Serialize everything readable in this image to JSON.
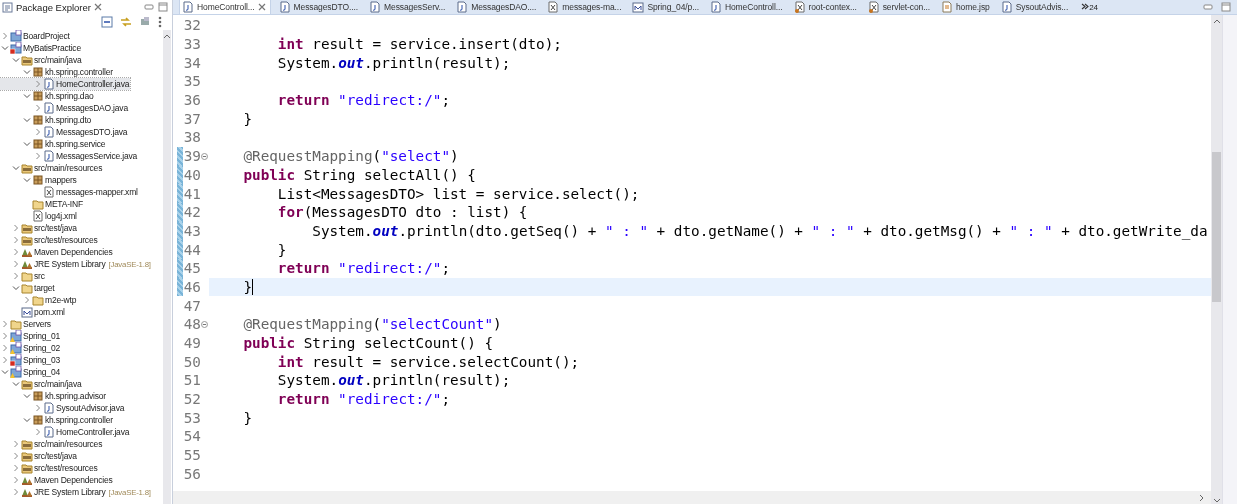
{
  "explorer": {
    "title": "Package Explorer",
    "tree": [
      {
        "label": "BoardProject",
        "kind": "project",
        "error": false,
        "warning": false,
        "expanded": false
      },
      {
        "label": "MyBatisPractice",
        "kind": "project",
        "error": true,
        "warning": false,
        "expanded": true,
        "children": [
          {
            "label": "src/main/java",
            "kind": "srcfolder",
            "expanded": true,
            "children": [
              {
                "label": "kh.spring.controller",
                "kind": "package",
                "expanded": true,
                "children": [
                  {
                    "label": "HomeController.java",
                    "kind": "java",
                    "expanded": false,
                    "selected": true
                  }
                ]
              },
              {
                "label": "kh.spring.dao",
                "kind": "package",
                "expanded": true,
                "children": [
                  {
                    "label": "MessagesDAO.java",
                    "kind": "java",
                    "expanded": false
                  }
                ]
              },
              {
                "label": "kh.spring.dto",
                "kind": "package",
                "expanded": true,
                "children": [
                  {
                    "label": "MessagesDTO.java",
                    "kind": "java",
                    "expanded": false
                  }
                ]
              },
              {
                "label": "kh.spring.service",
                "kind": "package",
                "expanded": true,
                "children": [
                  {
                    "label": "MessagesService.java",
                    "kind": "java",
                    "expanded": false
                  }
                ]
              }
            ]
          },
          {
            "label": "src/main/resources",
            "kind": "srcfolder",
            "expanded": true,
            "children": [
              {
                "label": "mappers",
                "kind": "package",
                "expanded": true,
                "children": [
                  {
                    "label": "messages-mapper.xml",
                    "kind": "xml"
                  }
                ]
              },
              {
                "label": "META-INF",
                "kind": "folder"
              },
              {
                "label": "log4j.xml",
                "kind": "xml"
              }
            ]
          },
          {
            "label": "src/test/java",
            "kind": "srcfolder",
            "expanded": false
          },
          {
            "label": "src/test/resources",
            "kind": "srcfolder",
            "expanded": false
          },
          {
            "label": "Maven Dependencies",
            "kind": "library",
            "expanded": false
          },
          {
            "label": "JRE System Library",
            "decoration": "[JavaSE-1.8]",
            "kind": "library",
            "expanded": false
          },
          {
            "label": "src",
            "kind": "folder",
            "expanded": false
          },
          {
            "label": "target",
            "kind": "folder",
            "expanded": true,
            "children": [
              {
                "label": "m2e-wtp",
                "kind": "folder",
                "expanded": false
              }
            ]
          },
          {
            "label": "pom.xml",
            "kind": "pom"
          }
        ]
      },
      {
        "label": "Servers",
        "kind": "folder",
        "expanded": false
      },
      {
        "label": "Spring_01",
        "kind": "project",
        "error": false,
        "warning": true,
        "expanded": false
      },
      {
        "label": "Spring_02",
        "kind": "project",
        "error": false,
        "warning": true,
        "expanded": false
      },
      {
        "label": "Spring_03",
        "kind": "project",
        "error": true,
        "warning": false,
        "expanded": false
      },
      {
        "label": "Spring_04",
        "kind": "project",
        "error": false,
        "warning": true,
        "expanded": true,
        "children": [
          {
            "label": "src/main/java",
            "kind": "srcfolder",
            "expanded": true,
            "children": [
              {
                "label": "kh.spring.advisor",
                "kind": "package",
                "expanded": true,
                "children": [
                  {
                    "label": "SysoutAdvisor.java",
                    "kind": "java",
                    "expanded": false
                  }
                ]
              },
              {
                "label": "kh.spring.controller",
                "kind": "package",
                "expanded": true,
                "children": [
                  {
                    "label": "HomeController.java",
                    "kind": "java",
                    "expanded": false
                  }
                ]
              }
            ]
          },
          {
            "label": "src/main/resources",
            "kind": "srcfolder",
            "expanded": false
          },
          {
            "label": "src/test/java",
            "kind": "srcfolder",
            "expanded": false
          },
          {
            "label": "src/test/resources",
            "kind": "srcfolder",
            "expanded": false
          },
          {
            "label": "Maven Dependencies",
            "kind": "library",
            "expanded": false
          },
          {
            "label": "JRE System Library",
            "decoration": "[JavaSE-1.8]",
            "kind": "library",
            "expanded": false
          }
        ]
      }
    ]
  },
  "editor": {
    "tabs": [
      {
        "label": "HomeControll...",
        "kind": "java",
        "selected": true
      },
      {
        "label": "MessagesDTO....",
        "kind": "java",
        "selected": false
      },
      {
        "label": "MessagesServ...",
        "kind": "java",
        "selected": false
      },
      {
        "label": "MessagesDAO....",
        "kind": "java",
        "selected": false
      },
      {
        "label": "messages-ma...",
        "kind": "xml",
        "selected": false
      },
      {
        "label": "Spring_04/p...",
        "kind": "pom",
        "selected": false
      },
      {
        "label": "HomeControll...",
        "kind": "java",
        "selected": false
      },
      {
        "label": "root-contex...",
        "kind": "springxml",
        "selected": false
      },
      {
        "label": "servlet-con...",
        "kind": "springxml",
        "selected": false
      },
      {
        "label": "home.jsp",
        "kind": "jsp",
        "selected": false
      },
      {
        "label": "SysoutAdvis...",
        "kind": "java",
        "selected": false
      }
    ],
    "overflow_count": "24",
    "lines": [
      {
        "number": "32"
      },
      {
        "number": "33",
        "tokens": [
          {
            "kind": "keyword",
            "text": "        int"
          },
          {
            "kind": "plain",
            "text": " result = service.insert(dto);"
          }
        ]
      },
      {
        "number": "34",
        "tokens": [
          {
            "kind": "plain",
            "text": "        System."
          },
          {
            "kind": "field",
            "text": "out"
          },
          {
            "kind": "plain",
            "text": ".println(result);"
          }
        ]
      },
      {
        "number": "35"
      },
      {
        "number": "36",
        "tokens": [
          {
            "kind": "keyword",
            "text": "        return"
          },
          {
            "kind": "string",
            "text": " \"redirect:/\""
          },
          {
            "kind": "plain",
            "text": ";"
          }
        ]
      },
      {
        "number": "37",
        "tokens": [
          {
            "kind": "plain",
            "text": "    }"
          }
        ]
      },
      {
        "number": "38"
      },
      {
        "number": "39",
        "fold": true,
        "changed": true,
        "tokens": [
          {
            "kind": "annotation",
            "text": "    @RequestMapping"
          },
          {
            "kind": "plain",
            "text": "("
          },
          {
            "kind": "string",
            "text": "\"select\""
          },
          {
            "kind": "plain",
            "text": ")"
          }
        ]
      },
      {
        "number": "40",
        "changed": true,
        "tokens": [
          {
            "kind": "keyword",
            "text": "    public"
          },
          {
            "kind": "plain",
            "text": " String selectAll() {"
          }
        ]
      },
      {
        "number": "41",
        "changed": true,
        "tokens": [
          {
            "kind": "plain",
            "text": "        List<MessagesDTO> list = service.select();"
          }
        ]
      },
      {
        "number": "42",
        "changed": true,
        "tokens": [
          {
            "kind": "keyword",
            "text": "        for"
          },
          {
            "kind": "plain",
            "text": "(MessagesDTO dto : list) {"
          }
        ]
      },
      {
        "number": "43",
        "changed": true,
        "tokens": [
          {
            "kind": "plain",
            "text": "            System."
          },
          {
            "kind": "field",
            "text": "out"
          },
          {
            "kind": "plain",
            "text": ".println(dto.getSeq() + "
          },
          {
            "kind": "string",
            "text": "\" : \""
          },
          {
            "kind": "plain",
            "text": " + dto.getName() + "
          },
          {
            "kind": "string",
            "text": "\" : \""
          },
          {
            "kind": "plain",
            "text": " + dto.getMsg() + "
          },
          {
            "kind": "string",
            "text": "\" : \""
          },
          {
            "kind": "plain",
            "text": " + dto.getWrite_da"
          }
        ]
      },
      {
        "number": "44",
        "changed": true,
        "tokens": [
          {
            "kind": "plain",
            "text": "        }"
          }
        ]
      },
      {
        "number": "45",
        "changed": true,
        "tokens": [
          {
            "kind": "keyword",
            "text": "        return"
          },
          {
            "kind": "string",
            "text": " \"redirect:/\""
          },
          {
            "kind": "plain",
            "text": ";"
          }
        ]
      },
      {
        "number": "46",
        "changed": true,
        "current": true,
        "tokens": [
          {
            "kind": "plain",
            "text": "    }"
          }
        ]
      },
      {
        "number": "47"
      },
      {
        "number": "48",
        "fold": true,
        "tokens": [
          {
            "kind": "annotation",
            "text": "    @RequestMapping"
          },
          {
            "kind": "plain",
            "text": "("
          },
          {
            "kind": "string",
            "text": "\"selectCount\""
          },
          {
            "kind": "plain",
            "text": ")"
          }
        ]
      },
      {
        "number": "49",
        "tokens": [
          {
            "kind": "keyword",
            "text": "    public"
          },
          {
            "kind": "plain",
            "text": " String selectCount() {"
          }
        ]
      },
      {
        "number": "50",
        "tokens": [
          {
            "kind": "keyword",
            "text": "        int"
          },
          {
            "kind": "plain",
            "text": " result = service.selectCount();"
          }
        ]
      },
      {
        "number": "51",
        "tokens": [
          {
            "kind": "plain",
            "text": "        System."
          },
          {
            "kind": "field",
            "text": "out"
          },
          {
            "kind": "plain",
            "text": ".println(result);"
          }
        ]
      },
      {
        "number": "52",
        "tokens": [
          {
            "kind": "keyword",
            "text": "        return"
          },
          {
            "kind": "string",
            "text": " \"redirect:/\""
          },
          {
            "kind": "plain",
            "text": ";"
          }
        ]
      },
      {
        "number": "53",
        "tokens": [
          {
            "kind": "plain",
            "text": "    }"
          }
        ]
      },
      {
        "number": "54"
      },
      {
        "number": "55"
      },
      {
        "number": "56"
      }
    ]
  }
}
